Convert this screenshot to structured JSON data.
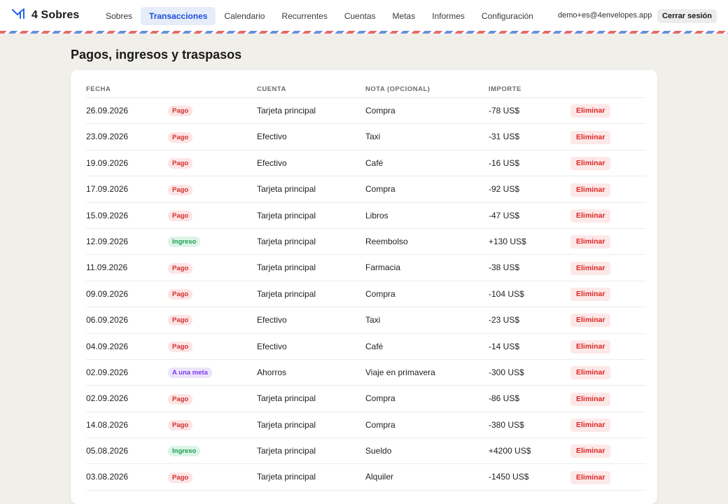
{
  "brand": {
    "name": "4 Sobres",
    "logo_icon": "envelope-logo-icon",
    "accent": "#2563eb"
  },
  "nav": {
    "items": [
      {
        "label": "Sobres",
        "active": false
      },
      {
        "label": "Transacciones",
        "active": true
      },
      {
        "label": "Calendario",
        "active": false
      },
      {
        "label": "Recurrentes",
        "active": false
      },
      {
        "label": "Cuentas",
        "active": false
      },
      {
        "label": "Metas",
        "active": false
      },
      {
        "label": "Informes",
        "active": false
      },
      {
        "label": "Configuración",
        "active": false
      }
    ]
  },
  "user": {
    "email": "demo+es@4envelopes.app",
    "logout_label": "Cerrar sesión"
  },
  "page": {
    "title": "Pagos, ingresos y traspasos"
  },
  "table": {
    "headers": {
      "date": "FECHA",
      "account": "CUENTA",
      "note": "NOTA (OPCIONAL)",
      "amount": "IMPORTE"
    },
    "delete_label": "Eliminar",
    "rows": [
      {
        "date": "26.09.2026",
        "type": "Pago",
        "kind": "pago",
        "account": "Tarjeta principal",
        "note": "Compra",
        "amount": "-78 US$"
      },
      {
        "date": "23.09.2026",
        "type": "Pago",
        "kind": "pago",
        "account": "Efectivo",
        "note": "Taxi",
        "amount": "-31 US$"
      },
      {
        "date": "19.09.2026",
        "type": "Pago",
        "kind": "pago",
        "account": "Efectivo",
        "note": "Café",
        "amount": "-16 US$"
      },
      {
        "date": "17.09.2026",
        "type": "Pago",
        "kind": "pago",
        "account": "Tarjeta principal",
        "note": "Compra",
        "amount": "-92 US$"
      },
      {
        "date": "15.09.2026",
        "type": "Pago",
        "kind": "pago",
        "account": "Tarjeta principal",
        "note": "Libros",
        "amount": "-47 US$"
      },
      {
        "date": "12.09.2026",
        "type": "Ingreso",
        "kind": "ingreso",
        "account": "Tarjeta principal",
        "note": "Reembolso",
        "amount": "+130 US$"
      },
      {
        "date": "11.09.2026",
        "type": "Pago",
        "kind": "pago",
        "account": "Tarjeta principal",
        "note": "Farmacia",
        "amount": "-38 US$"
      },
      {
        "date": "09.09.2026",
        "type": "Pago",
        "kind": "pago",
        "account": "Tarjeta principal",
        "note": "Compra",
        "amount": "-104 US$"
      },
      {
        "date": "06.09.2026",
        "type": "Pago",
        "kind": "pago",
        "account": "Efectivo",
        "note": "Taxi",
        "amount": "-23 US$"
      },
      {
        "date": "04.09.2026",
        "type": "Pago",
        "kind": "pago",
        "account": "Efectivo",
        "note": "Café",
        "amount": "-14 US$"
      },
      {
        "date": "02.09.2026",
        "type": "A una meta",
        "kind": "meta",
        "account": "Ahorros",
        "note": "Viaje en primavera",
        "amount": "-300 US$"
      },
      {
        "date": "02.09.2026",
        "type": "Pago",
        "kind": "pago",
        "account": "Tarjeta principal",
        "note": "Compra",
        "amount": "-86 US$"
      },
      {
        "date": "14.08.2026",
        "type": "Pago",
        "kind": "pago",
        "account": "Tarjeta principal",
        "note": "Compra",
        "amount": "-380 US$"
      },
      {
        "date": "05.08.2026",
        "type": "Ingreso",
        "kind": "ingreso",
        "account": "Tarjeta principal",
        "note": "Sueldo",
        "amount": "+4200 US$"
      },
      {
        "date": "03.08.2026",
        "type": "Pago",
        "kind": "pago",
        "account": "Tarjeta principal",
        "note": "Alquiler",
        "amount": "-1450 US$"
      }
    ]
  }
}
